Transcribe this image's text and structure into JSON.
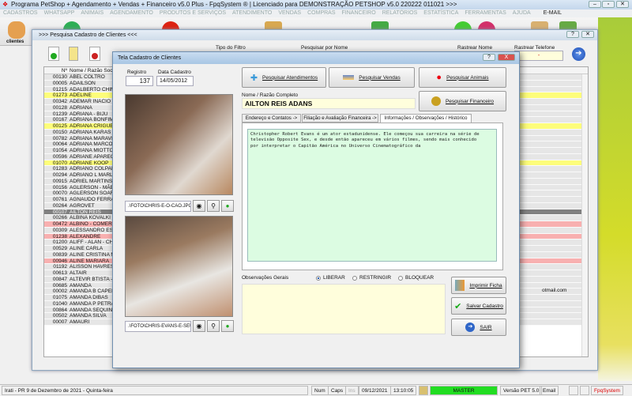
{
  "app": {
    "title": "Programa PetShop + Agendamento + Vendas + Financeiro v5.0 Plus - FpqSystem ® | Licenciado para  DEMONSTRAÇÃO PETSHOP v5.0 220222 011021 >>>"
  },
  "menu": [
    "CADASTROS",
    "WHATSAPP",
    "ANIMAIS",
    "AGENDAMENTO",
    "PRODUTOS E SERVIÇOS",
    "ATENDIMENTO",
    "VENDAS",
    "COMPRAS",
    "FINANCEIRO",
    "RELATÓRIOS",
    "ESTATÍSTICA",
    "FERRAMENTAS",
    "AJUDA",
    "E-MAIL"
  ],
  "toolbar": {
    "clientes_label": "clientes"
  },
  "search_window": {
    "title": ">>> Pesquisa Cadastro de Clientes <<<",
    "filter_type_label": "Tipo do Filtro",
    "search_name_label": "Pesquisar por Nome",
    "track_name_label": "Rastrear Nome",
    "track_phone_label": "Rastrear Telefone",
    "track_phone_value": "-",
    "help": "?",
    "close": "✕",
    "columns": [
      "Nº",
      "Nome / Razão Social"
    ],
    "rows": [
      {
        "n": "00130",
        "name": "ABEL COLTRO",
        "status": "normal"
      },
      {
        "n": "00005",
        "name": "ADAILSON",
        "status": "normal"
      },
      {
        "n": "01215",
        "name": "ADALBERTO CHIM",
        "status": "normal"
      },
      {
        "n": "01273",
        "name": "ADELINE",
        "status": "yellow"
      },
      {
        "n": "00342",
        "name": "ADEMAR INACIO B",
        "status": "normal"
      },
      {
        "n": "00128",
        "name": "ADRIANA",
        "status": "normal"
      },
      {
        "n": "01239",
        "name": "ADRIANA - BIJU",
        "status": "normal"
      },
      {
        "n": "00167",
        "name": "ADRIANA BONFIM",
        "status": "normal"
      },
      {
        "n": "00125",
        "name": "ADRIANA CRIGUEI",
        "status": "yellow"
      },
      {
        "n": "00150",
        "name": "ADRIANA KARAS",
        "status": "normal"
      },
      {
        "n": "00782",
        "name": "ADRIANA MARAVI",
        "status": "normal"
      },
      {
        "n": "00064",
        "name": "ADRIANA MARCO",
        "status": "normal"
      },
      {
        "n": "01054",
        "name": "ADRIANA MIOTTO",
        "status": "normal"
      },
      {
        "n": "00596",
        "name": "ADRIANE APARECI",
        "status": "normal"
      },
      {
        "n": "01070",
        "name": "ADRIANE KOOP",
        "status": "yellow"
      },
      {
        "n": "01283",
        "name": "ADRIANO COLPAN",
        "status": "normal"
      },
      {
        "n": "00294",
        "name": "ADRIANO L MARLI",
        "status": "normal"
      },
      {
        "n": "00915",
        "name": "ADRIEL MARTINS",
        "status": "normal"
      },
      {
        "n": "00156",
        "name": "AGLERSON - MÃE",
        "status": "normal"
      },
      {
        "n": "00070",
        "name": "AGLERSON SOARE",
        "status": "normal"
      },
      {
        "n": "00761",
        "name": "AGNAUDO FERRA",
        "status": "normal"
      },
      {
        "n": "00264",
        "name": "AGROVET",
        "status": "normal"
      },
      {
        "n": "00107",
        "name": "AILTON REIS",
        "status": "selected"
      },
      {
        "n": "00266",
        "name": "ALBINA KOVALKI",
        "status": "normal"
      },
      {
        "n": "00472",
        "name": "ALBINO - COMERC",
        "status": "pink"
      },
      {
        "n": "00309",
        "name": "ALESSANDRO ESN",
        "status": "normal"
      },
      {
        "n": "01238",
        "name": "ALEXANDRE",
        "status": "pink"
      },
      {
        "n": "01200",
        "name": "ALIFF - ALAN - CHI",
        "status": "normal"
      },
      {
        "n": "00529",
        "name": "ALINE CARLA",
        "status": "normal"
      },
      {
        "n": "00839",
        "name": "ALINE CRISTINA M",
        "status": "normal"
      },
      {
        "n": "00946",
        "name": "ALINE MARIARA",
        "status": "pink"
      },
      {
        "n": "01192",
        "name": "ALISSON HAVRESI",
        "status": "normal"
      },
      {
        "n": "00613",
        "name": "ALTAIR",
        "status": "normal"
      },
      {
        "n": "00847",
        "name": "ALTEVIR BTISTA -",
        "status": "normal"
      },
      {
        "n": "00685",
        "name": "AMANDA",
        "status": "normal"
      },
      {
        "n": "00002",
        "name": "AMANDA B CAPELI",
        "status": "normal"
      },
      {
        "n": "01075",
        "name": "AMANDA DIBAS",
        "status": "normal"
      },
      {
        "n": "01040",
        "name": "AMANDA P PETRA",
        "status": "normal"
      },
      {
        "n": "00864",
        "name": "AMANDA SEQUINE",
        "status": "normal"
      },
      {
        "n": "00502",
        "name": "AMANDA SILVA",
        "status": "normal"
      },
      {
        "n": "00007",
        "name": "AMAURI",
        "status": "normal"
      }
    ],
    "email_fragment": "otmail.com"
  },
  "dialog": {
    "title": "Tela Cadastro de Clientes",
    "help": "?",
    "close": "X",
    "registro_label": "Registro",
    "registro_value": "137",
    "data_label": "Data Cadastro",
    "data_value": "14/05/2012",
    "photo1_path": ".\\FOTO\\CHRIS-E-O-CAO.JPG",
    "photo2_path": ".\\FOTO\\CHRIS-EVANS-E-SEU",
    "buttons": {
      "atendimentos": "Pesquisar  Atendimentos",
      "vendas": "Pesquisar Vendas",
      "animais": "Pesquisar Animais",
      "financeiro": "Pesquisar  Financeiro",
      "imprimir": "Imprimir Ficha",
      "salvar": "Salvar Cadastro",
      "sair": "SAIR"
    },
    "nome_label": "Nome / Razão Completo",
    "nome_value": "AILTON REIS ADANS",
    "tabs": [
      "Endereço e Contatos ->",
      "Filiação e Avaliação Financeira ->",
      "Informações / Observações / Histórico"
    ],
    "active_tab": 2,
    "history_text": "Christopher Robert Evans é um ator estadunidense. Ele começou sua carreira na série de televisão Opposite Sex, e desde então apareceu em vários filmes, sendo mais conhecido por interpretar o Capitão América no Universo Cinematográfico da",
    "obs_label": "Observações Gerais",
    "radios": [
      "LIBERAR",
      "RESTRINGIR",
      "BLOQUEAR"
    ],
    "radio_selected": "LIBERAR"
  },
  "statusbar": {
    "location": "Irati - PR  9 de Dezembro de 2021 - Quinta-feira",
    "num": "Num",
    "caps": "Caps",
    "ins": "Ins",
    "date": "09/12/2021",
    "time": "13:10:05",
    "user": "MASTER",
    "version": "Versão PET 5.0",
    "email": "Email",
    "brand": "FpqSystem"
  },
  "colors": {
    "yellow_row": "#fdfd7a",
    "pink_row": "#f8b0b0",
    "selected_row": "#808080",
    "history_bg": "#dcfce2",
    "obs_bg": "#fffedc",
    "master_bg": "#22dd22"
  }
}
